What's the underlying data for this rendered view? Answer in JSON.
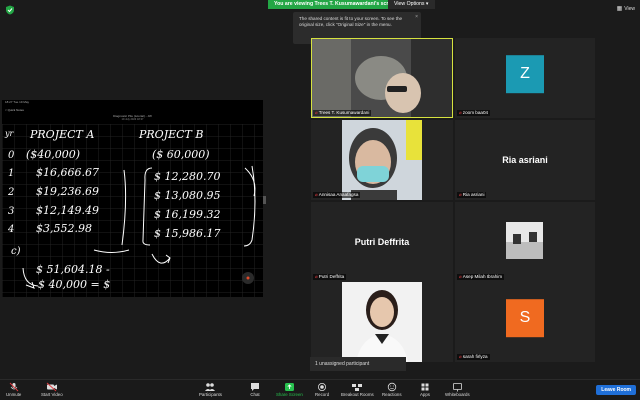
{
  "topbar": {
    "viewing_text": "You are viewing Trees T. Kusumawardani's screen",
    "view_options_label": "View Options",
    "view_label": "View"
  },
  "tooltip": {
    "text": "The shared content is fit to your screen. To see the original size, click \"Original Size\" in the menu."
  },
  "shared_screen": {
    "status_time": "18:27  Tue 19 May",
    "toolbar_left": "< Quick Notes",
    "doc_title": "Diagnostic Pile (tutorial) - JW",
    "doc_date": "19 July 2023 18:37",
    "handwriting": {
      "proj_a": "PROJECT A",
      "proj_b": "PROJECT B",
      "yr": "yr",
      "row0": "0",
      "row1": "1",
      "row2": "2",
      "row3": "3",
      "row4": "4",
      "a0": "($40,000)",
      "b0": "($ 60,000)",
      "a1": "$16,666.67",
      "a2": "$19,236.69",
      "a3": "$12,149.49",
      "a4": "$3,552.98",
      "b1": "$ 12,280.70",
      "b2": "$ 13,080.95",
      "b3": "$ 16,199.32",
      "b4": "$ 15,986.17",
      "c_label": "c)",
      "c1": "$ 51,604.18 -",
      "c2": "$ 40,000 = $"
    }
  },
  "participants": [
    {
      "name": "Trees T. Kusumawardani",
      "type": "video",
      "active": true
    },
    {
      "name": "zoom baa04",
      "type": "avatar",
      "initial": "Z",
      "color": "#1b9ab3"
    },
    {
      "name": "Annisaa Anaafagsa",
      "type": "video"
    },
    {
      "name": "Ria asriani",
      "type": "name"
    },
    {
      "name": "Putri Deffrita",
      "type": "name"
    },
    {
      "name": "Asep Milah Ibrahim",
      "type": "video"
    },
    {
      "name": "",
      "type": "photo"
    },
    {
      "name": "sarah firlyza",
      "type": "avatar",
      "initial": "S",
      "color": "#f06a20"
    }
  ],
  "unassigned_text": "1 unassigned participant",
  "toolbar": {
    "unmute": "Unmute",
    "start_video": "Start Video",
    "participants": "Participants",
    "participants_count": "10",
    "chat": "Chat",
    "share_screen": "Share Screen",
    "record": "Record",
    "breakout": "Breakout Rooms",
    "reactions": "Reactions",
    "apps": "Apps",
    "whiteboards": "Whiteboards",
    "leave": "Leave Room"
  },
  "colors": {
    "accent_green": "#23a645",
    "leave_blue": "#1f6fd8",
    "active_border": "#d6e23f",
    "muted_red": "#e0393e"
  }
}
